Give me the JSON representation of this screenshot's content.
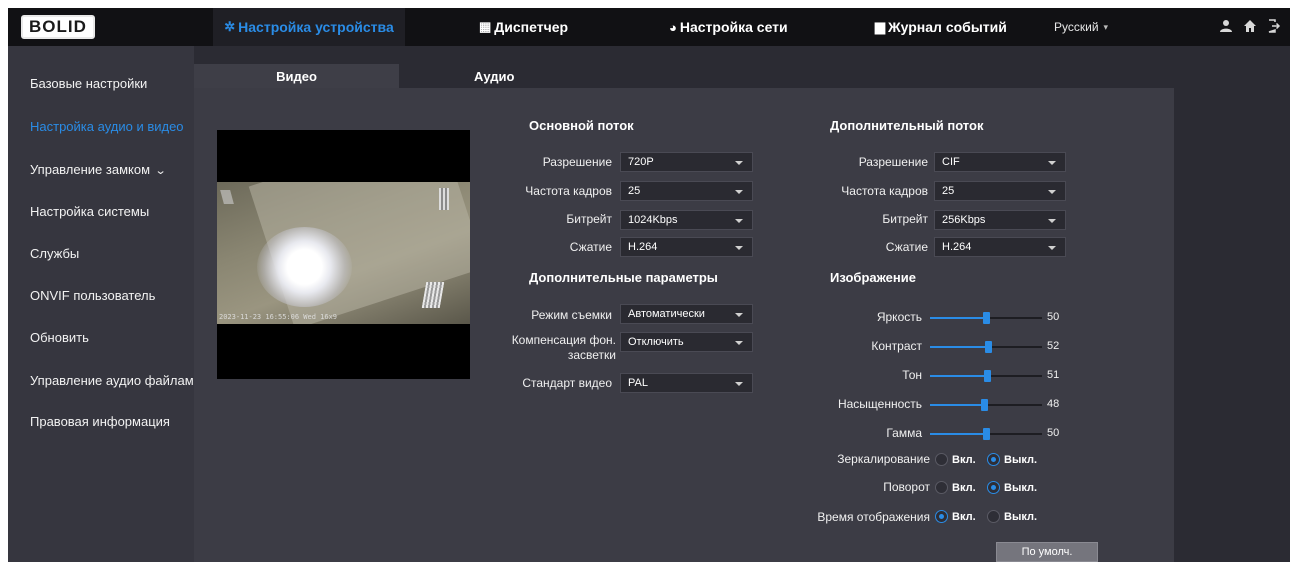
{
  "brand": {
    "logo_text": "BOLID"
  },
  "topnav": {
    "items": [
      {
        "label": "Настройка устройства",
        "icon": "gear-icon",
        "active": true
      },
      {
        "label": "Диспетчер",
        "icon": "grid-monitor-icon",
        "active": false
      },
      {
        "label": "Настройка сети",
        "icon": "globe-icon",
        "active": false
      },
      {
        "label": "Журнал событий",
        "icon": "log-book-icon",
        "active": false
      }
    ],
    "language": "Русский"
  },
  "sidebar": {
    "items": [
      {
        "label": "Базовые настройки",
        "active": false
      },
      {
        "label": "Настройка аудио и видео",
        "active": true
      },
      {
        "label": "Управление замком",
        "active": false,
        "expandable": true
      },
      {
        "label": "Настройка системы",
        "active": false
      },
      {
        "label": "Службы",
        "active": false
      },
      {
        "label": "ONVIF пользователь",
        "active": false
      },
      {
        "label": "Обновить",
        "active": false
      },
      {
        "label": "Управление аудио файлами",
        "active": false
      },
      {
        "label": "Правовая информация",
        "active": false
      }
    ]
  },
  "tabs": [
    {
      "label": "Видео",
      "active": true
    },
    {
      "label": "Аудио",
      "active": false
    }
  ],
  "preview": {
    "osd": "2023-11-23 16:55:06 Wed 16x9"
  },
  "main_stream": {
    "title": "Основной поток",
    "rows": [
      {
        "label": "Разрешение",
        "value": "720P"
      },
      {
        "label": "Частота кадров",
        "value": "25"
      },
      {
        "label": "Битрейт",
        "value": "1024Kbps"
      },
      {
        "label": "Сжатие",
        "value": "H.264"
      }
    ]
  },
  "sub_stream": {
    "title": "Дополнительный поток",
    "rows": [
      {
        "label": "Разрешение",
        "value": "CIF"
      },
      {
        "label": "Частота кадров",
        "value": "25"
      },
      {
        "label": "Битрейт",
        "value": "256Kbps"
      },
      {
        "label": "Сжатие",
        "value": "H.264"
      }
    ]
  },
  "extra": {
    "title": "Дополнительные параметры",
    "rows": [
      {
        "label": "Режим съемки",
        "value": "Автоматически"
      },
      {
        "label": "Компенсация фон. засветки",
        "value": "Отключить"
      },
      {
        "label": "Стандарт видео",
        "value": "PAL"
      }
    ]
  },
  "image": {
    "title": "Изображение",
    "sliders": [
      {
        "label": "Яркость",
        "value": 50
      },
      {
        "label": "Контраст",
        "value": 52
      },
      {
        "label": "Тон",
        "value": 51
      },
      {
        "label": "Насыщенность",
        "value": 48
      },
      {
        "label": "Гамма",
        "value": 50
      }
    ],
    "toggles": [
      {
        "label": "Зеркалирование",
        "on_label": "Вкл.",
        "off_label": "Выкл.",
        "selected": "off"
      },
      {
        "label": "Поворот",
        "on_label": "Вкл.",
        "off_label": "Выкл.",
        "selected": "off"
      },
      {
        "label": "Время отображения",
        "on_label": "Вкл.",
        "off_label": "Выкл.",
        "selected": "on"
      }
    ]
  },
  "default_button": "По умолч.",
  "colors": {
    "accent": "#2a8ce6",
    "topbar": "#111114",
    "panel": "#3c3c45"
  }
}
